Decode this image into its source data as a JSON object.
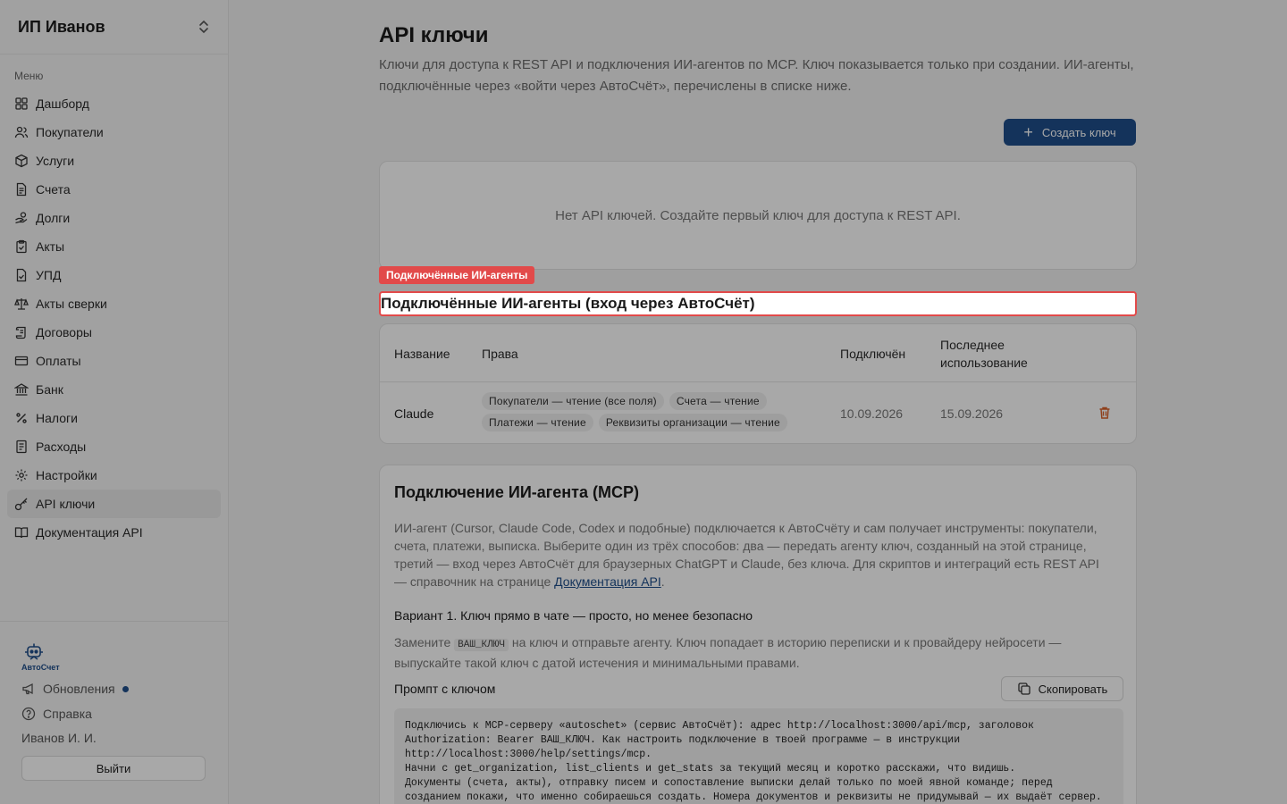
{
  "sidebar": {
    "org_name": "ИП Иванов",
    "menu_title": "Меню",
    "items": [
      {
        "label": "Дашборд",
        "icon": "dashboard-icon"
      },
      {
        "label": "Покупатели",
        "icon": "users-icon"
      },
      {
        "label": "Услуги",
        "icon": "box-icon"
      },
      {
        "label": "Счета",
        "icon": "document-icon"
      },
      {
        "label": "Долги",
        "icon": "hand-coins-icon"
      },
      {
        "label": "Акты",
        "icon": "clipboard-check-icon"
      },
      {
        "label": "УПД",
        "icon": "file-check-icon"
      },
      {
        "label": "Акты сверки",
        "icon": "scale-icon"
      },
      {
        "label": "Договоры",
        "icon": "scroll-icon"
      },
      {
        "label": "Оплаты",
        "icon": "credit-card-icon"
      },
      {
        "label": "Банк",
        "icon": "bank-icon"
      },
      {
        "label": "Налоги",
        "icon": "percent-icon"
      },
      {
        "label": "Расходы",
        "icon": "receipt-icon"
      },
      {
        "label": "Настройки",
        "icon": "gear-icon"
      },
      {
        "label": "API ключи",
        "icon": "key-icon"
      },
      {
        "label": "Документация API",
        "icon": "book-open-icon"
      }
    ],
    "active_index": 14,
    "logo_text": "АвтоСчет",
    "updates_label": "Обновления",
    "help_label": "Справка",
    "user_name": "Иванов И. И.",
    "logout_label": "Выйти"
  },
  "main": {
    "title": "API ключи",
    "description": "Ключи для доступа к REST API и подключения ИИ-агентов по MCP. Ключ показывается только при создании. ИИ-агенты, подключённые через «войти через АвтоСчёт», перечислены в списке ниже.",
    "create_button": "Создать ключ",
    "empty_text": "Нет API ключей. Создайте первый ключ для доступа к REST API.",
    "agents_tag": "Подключённые ИИ-агенты",
    "agents_heading": "Подключённые ИИ-агенты (вход через АвтоСчёт)",
    "table": {
      "headers": {
        "name": "Название",
        "rights": "Права",
        "connected": "Подключён",
        "last_used": "Последнее использование"
      },
      "rows": [
        {
          "name": "Claude",
          "rights": [
            "Покупатели — чтение (все поля)",
            "Счета — чтение",
            "Платежи — чтение",
            "Реквизиты организации — чтение"
          ],
          "connected": "10.09.2026",
          "last_used": "15.09.2026"
        }
      ]
    },
    "mcp": {
      "title": "Подключение ИИ-агента (MCP)",
      "description_before_link": "ИИ-агент (Cursor, Claude Code, Codex и подобные) подключается к АвтоСчёту и сам получает инструменты: покупатели, счета, платежи, выписка. Выберите один из трёх способов: два — передать агенту ключ, созданный на этой странице, третий — вход через АвтоСчёт для браузерных ChatGPT и Claude, без ключа. Для скриптов и интеграций есть REST API — справочник на странице ",
      "link_text": "Документация API",
      "description_after_link": ".",
      "variant1_title": "Вариант 1. Ключ прямо в чате — просто, но менее безопасно",
      "variant1_before": "Замените ",
      "variant1_code": "ВАШ_КЛЮЧ",
      "variant1_after": " на ключ и отправьте агенту. Ключ попадает в историю переписки и к провайдеру нейросети — выпускайте такой ключ с датой истечения и минимальными правами.",
      "prompt_label": "Промпт с ключом",
      "copy_button": "Скопировать",
      "prompt_text": "Подключись к MCP-серверу «autoschet» (сервис АвтоСчёт): адрес http://localhost:3000/api/mcp, заголовок\nAuthorization: Bearer ВАШ_КЛЮЧ. Как настроить подключение в твоей программе — в инструкции\nhttp://localhost:3000/help/settings/mcp.\nНачни с get_organization, list_clients и get_stats за текущий месяц и коротко расскажи, что видишь.\nДокументы (счета, акты), отправку писем и сопоставление выписки делай только по моей явной команде; перед\nсозданием покажи, что именно собираешься создать. Номера документов и реквизиты не придумывай — их выдаёт сервер."
    }
  },
  "colors": {
    "accent": "#1f4e8a",
    "highlight": "#e24a4a",
    "trash": "#d9622b"
  }
}
